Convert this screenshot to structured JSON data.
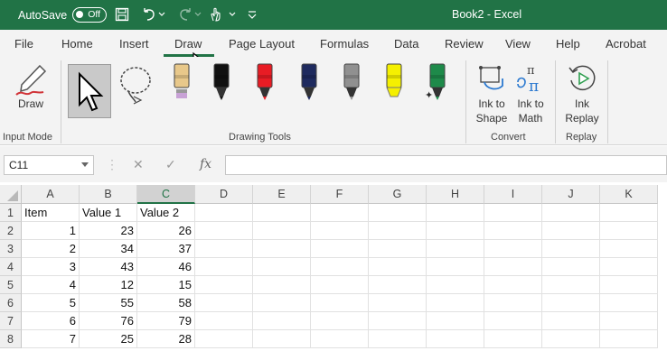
{
  "title_bar": {
    "autosave_label": "AutoSave",
    "autosave_state": "Off",
    "document_title": "Book2  -  Excel",
    "background_color": "#217346"
  },
  "tabs": [
    {
      "label": "File"
    },
    {
      "label": "Home"
    },
    {
      "label": "Insert"
    },
    {
      "label": "Draw"
    },
    {
      "label": "Page Layout"
    },
    {
      "label": "Formulas"
    },
    {
      "label": "Data"
    },
    {
      "label": "Review"
    },
    {
      "label": "View"
    },
    {
      "label": "Help"
    },
    {
      "label": "Acrobat"
    }
  ],
  "active_tab": "Draw",
  "ribbon": {
    "draw_button": "Draw",
    "input_mode_label": "Input Mode",
    "drawing_tools_label": "Drawing Tools",
    "ink_to_shape": [
      "Ink to",
      "Shape"
    ],
    "ink_to_math": [
      "Ink to",
      "Math"
    ],
    "convert_label": "Convert",
    "ink_replay": [
      "Ink",
      "Replay"
    ],
    "replay_label": "Replay",
    "pen_colors": [
      "#e8c88a",
      "#111111",
      "#e81c24",
      "#1e2a5e",
      "#909090",
      "#f5f000",
      "#1e8a4a"
    ]
  },
  "formula_bar": {
    "name_box": "C11",
    "fx_symbol": "fx",
    "formula": ""
  },
  "sheet": {
    "columns": [
      "A",
      "B",
      "C",
      "D",
      "E",
      "F",
      "G",
      "H",
      "I",
      "J",
      "K"
    ],
    "selected_column": "C",
    "row_numbers": [
      "1",
      "2",
      "3",
      "4",
      "5",
      "6",
      "7",
      "8"
    ],
    "rows": [
      [
        "Item",
        "Value 1",
        "Value 2"
      ],
      [
        "1",
        "23",
        "26"
      ],
      [
        "2",
        "34",
        "37"
      ],
      [
        "3",
        "43",
        "46"
      ],
      [
        "4",
        "12",
        "15"
      ],
      [
        "5",
        "55",
        "58"
      ],
      [
        "6",
        "76",
        "79"
      ],
      [
        "7",
        "25",
        "28"
      ]
    ]
  }
}
